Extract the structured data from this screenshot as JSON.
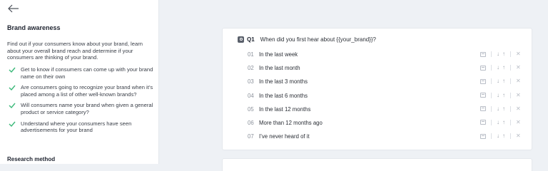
{
  "sidebar": {
    "title": "Brand awareness",
    "description": "Find out if your consumers know about your brand, learn about your overall brand reach and determine if your consumers are thinking of your brand.",
    "bullets": [
      "Get to know if consumers can come up with your brand name on their own",
      "Are consumers going to recognize your brand when it’s placed among a list of other well-known brands?",
      "Will consumers name your brand when given a general product or service category?",
      "Understand where your consumers have seen advertisements for your brand"
    ],
    "section_heading": "Research method"
  },
  "question": {
    "number": "Q1",
    "text": "When did you first hear about {{your_brand}}?",
    "answers": [
      {
        "num": "01",
        "text": "In the last week"
      },
      {
        "num": "02",
        "text": "In the last month"
      },
      {
        "num": "03",
        "text": "In the last 3 months"
      },
      {
        "num": "04",
        "text": "In the last 6 months"
      },
      {
        "num": "05",
        "text": "In the last 12 months"
      },
      {
        "num": "06",
        "text": "More than 12 months ago"
      },
      {
        "num": "07",
        "text": "I’ve never heard of it"
      }
    ]
  },
  "icons": {
    "back": "arrow-left-icon",
    "check": "check-icon",
    "question_type": "single-choice-icon",
    "image": "image-icon",
    "move_down": "arrow-down-icon",
    "move_up": "arrow-up-icon",
    "remove": "close-icon"
  },
  "colors": {
    "check": "#3cb97a",
    "background": "#eef1f5"
  }
}
